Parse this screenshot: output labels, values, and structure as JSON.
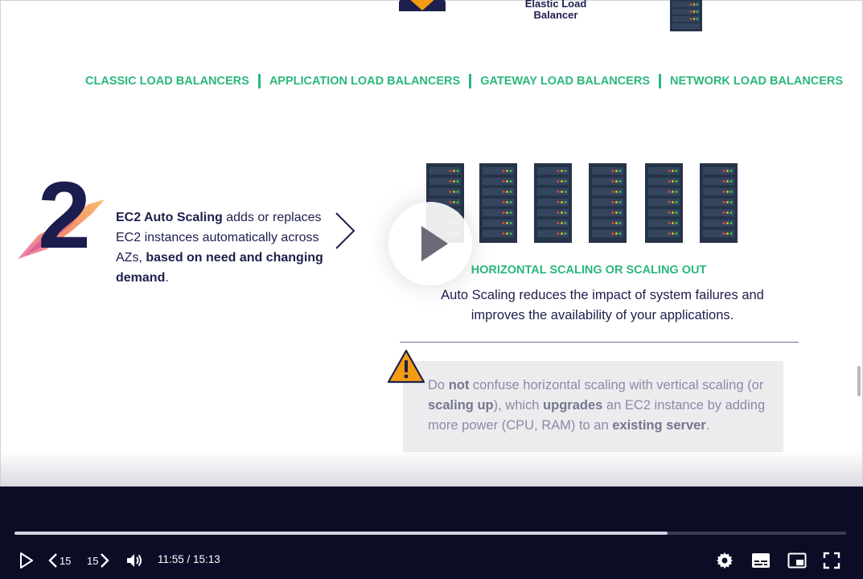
{
  "slide": {
    "elb_label": "Elastic Load\nBalancer",
    "lb_types": [
      "CLASSIC LOAD BALANCERS",
      "APPLICATION LOAD BALANCERS",
      "GATEWAY LOAD BALANCERS",
      "NETWORK LOAD BALANCERS"
    ],
    "section_number": "2",
    "description": {
      "bold1": "EC2 Auto Scaling",
      "text1": " adds or replaces EC2 instances automatically across AZs, ",
      "bold2": "based on need and changing demand",
      "text2": "."
    },
    "scaling_title": "HORIZONTAL SCALING OR SCALING OUT",
    "scaling_desc": "Auto Scaling reduces the impact of system failures and improves the availability of your applications.",
    "warning": {
      "t1": "Do ",
      "b1": "not",
      "t2": " confuse horizontal scaling with vertical scaling (or ",
      "b2": "scaling up",
      "t3": "), which ",
      "b3": "upgrades",
      "t4": " an EC2 instance by adding more power (CPU, RAM) to an ",
      "b4": "existing server",
      "t5": "."
    },
    "server_count": 6,
    "colors": {
      "accent_green": "#2ab87c",
      "navy": "#1d1f4d",
      "warning_orange": "#f39c12"
    }
  },
  "player": {
    "progress": 0.785,
    "skip_back": "15",
    "skip_forward": "15",
    "time": "11:55 / 15:13",
    "icons": [
      "play-icon",
      "rewind-15-icon",
      "forward-15-icon",
      "volume-icon",
      "settings-gear-icon",
      "captions-icon",
      "picture-in-picture-icon",
      "fullscreen-icon"
    ],
    "colors": {
      "bar_bg": "#0b0d26",
      "progress_fill": "#d1d2e0"
    }
  }
}
